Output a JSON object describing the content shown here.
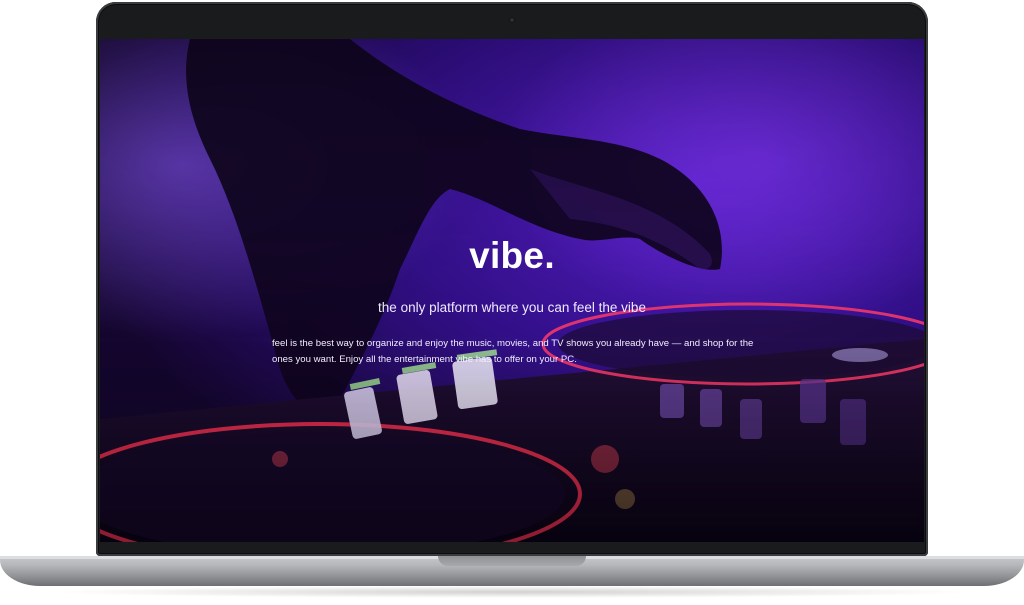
{
  "hero": {
    "title": "vibe.",
    "subtitle": "the only platform where you can feel the vibe",
    "body": "feel is the best way to organize and enjoy the music, movies, and TV shows you already have — and shop for the ones you want. Enjoy all the entertainment vibe has to offer on your PC."
  },
  "colors": {
    "background_tint": "#3a0e8a",
    "accent_pink": "#ff3b6b",
    "accent_green": "#b4ff9a",
    "bezel": "#1a1b1d",
    "chassis": "#b5b7ba"
  },
  "image": {
    "subject": "dj-hand-on-turntable"
  }
}
